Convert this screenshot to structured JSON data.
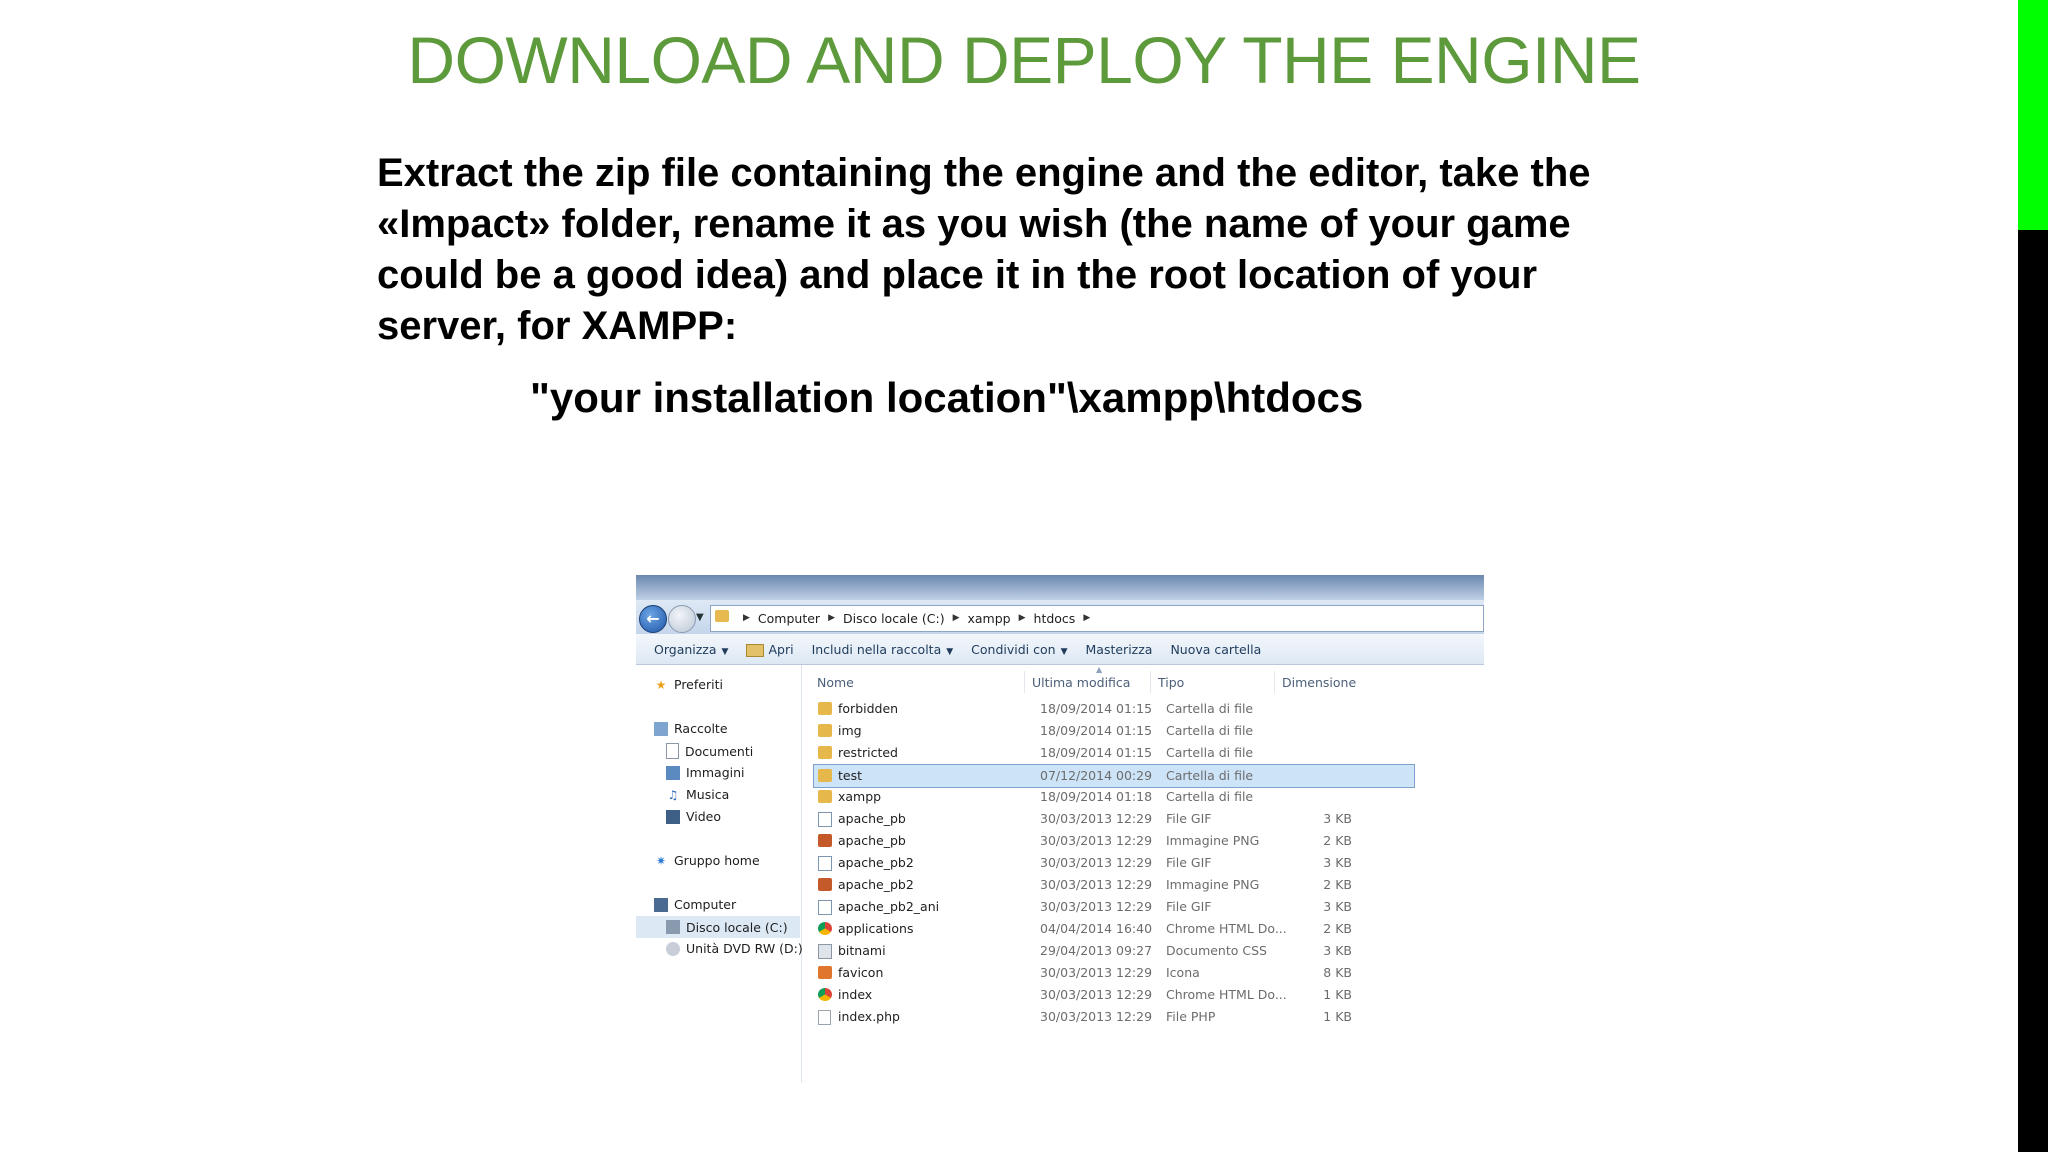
{
  "slide": {
    "title": "DOWNLOAD AND DEPLOY THE ENGINE",
    "body_lines": [
      "Extract the zip file containing the engine and the editor, take the",
      "«Impact» folder, rename it as you wish (the name of your game",
      "could be a good idea) and place it in the root location of your",
      "server, for XAMPP:"
    ],
    "path": "\"your installation location\"\\xampp\\htdocs",
    "accent_colors": {
      "title": "#5d9a3b",
      "side_green": "#00ff00",
      "side_black": "#000000"
    }
  },
  "explorer": {
    "address": {
      "crumbs": [
        "Computer",
        "Disco locale (C:)",
        "xampp",
        "htdocs"
      ]
    },
    "toolbar": {
      "organizza": "Organizza",
      "apri": "Apri",
      "includi": "Includi nella raccolta",
      "condividi": "Condividi con",
      "masterizza": "Masterizza",
      "nuova_cartella": "Nuova cartella"
    },
    "nav": {
      "preferiti": "Preferiti",
      "raccolte": "Raccolte",
      "documenti": "Documenti",
      "immagini": "Immagini",
      "musica": "Musica",
      "video": "Video",
      "gruppo_home": "Gruppo home",
      "computer": "Computer",
      "disco_locale": "Disco locale (C:)",
      "unita_dvd": "Unità DVD RW (D:) A"
    },
    "columns": {
      "name": "Nome",
      "modified": "Ultima modifica",
      "type": "Tipo",
      "size": "Dimensione"
    },
    "files": [
      {
        "name": "forbidden",
        "date": "18/09/2014 01:15",
        "type": "Cartella di file",
        "size": "",
        "icon": "folder-icon"
      },
      {
        "name": "img",
        "date": "18/09/2014 01:15",
        "type": "Cartella di file",
        "size": "",
        "icon": "folder-icon"
      },
      {
        "name": "restricted",
        "date": "18/09/2014 01:15",
        "type": "Cartella di file",
        "size": "",
        "icon": "folder-icon"
      },
      {
        "name": "test",
        "date": "07/12/2014 00:29",
        "type": "Cartella di file",
        "size": "",
        "icon": "folder-icon",
        "selected": true
      },
      {
        "name": "xampp",
        "date": "18/09/2014 01:18",
        "type": "Cartella di file",
        "size": "",
        "icon": "folder-icon"
      },
      {
        "name": "apache_pb",
        "date": "30/03/2013 12:29",
        "type": "File GIF",
        "size": "3 KB",
        "icon": "gif-file-icon"
      },
      {
        "name": "apache_pb",
        "date": "30/03/2013 12:29",
        "type": "Immagine PNG",
        "size": "2 KB",
        "icon": "png-file-icon"
      },
      {
        "name": "apache_pb2",
        "date": "30/03/2013 12:29",
        "type": "File GIF",
        "size": "3 KB",
        "icon": "gif-file-icon"
      },
      {
        "name": "apache_pb2",
        "date": "30/03/2013 12:29",
        "type": "Immagine PNG",
        "size": "2 KB",
        "icon": "png-file-icon"
      },
      {
        "name": "apache_pb2_ani",
        "date": "30/03/2013 12:29",
        "type": "File GIF",
        "size": "3 KB",
        "icon": "gif-file-icon"
      },
      {
        "name": "applications",
        "date": "04/04/2014 16:40",
        "type": "Chrome HTML Do...",
        "size": "2 KB",
        "icon": "chrome-file-icon"
      },
      {
        "name": "bitnami",
        "date": "29/04/2013 09:27",
        "type": "Documento CSS",
        "size": "3 KB",
        "icon": "css-file-icon"
      },
      {
        "name": "favicon",
        "date": "30/03/2013 12:29",
        "type": "Icona",
        "size": "8 KB",
        "icon": "ico-file-icon"
      },
      {
        "name": "index",
        "date": "30/03/2013 12:29",
        "type": "Chrome HTML Do...",
        "size": "1 KB",
        "icon": "chrome-file-icon"
      },
      {
        "name": "index.php",
        "date": "30/03/2013 12:29",
        "type": "File PHP",
        "size": "1 KB",
        "icon": "php-file-icon"
      }
    ]
  }
}
